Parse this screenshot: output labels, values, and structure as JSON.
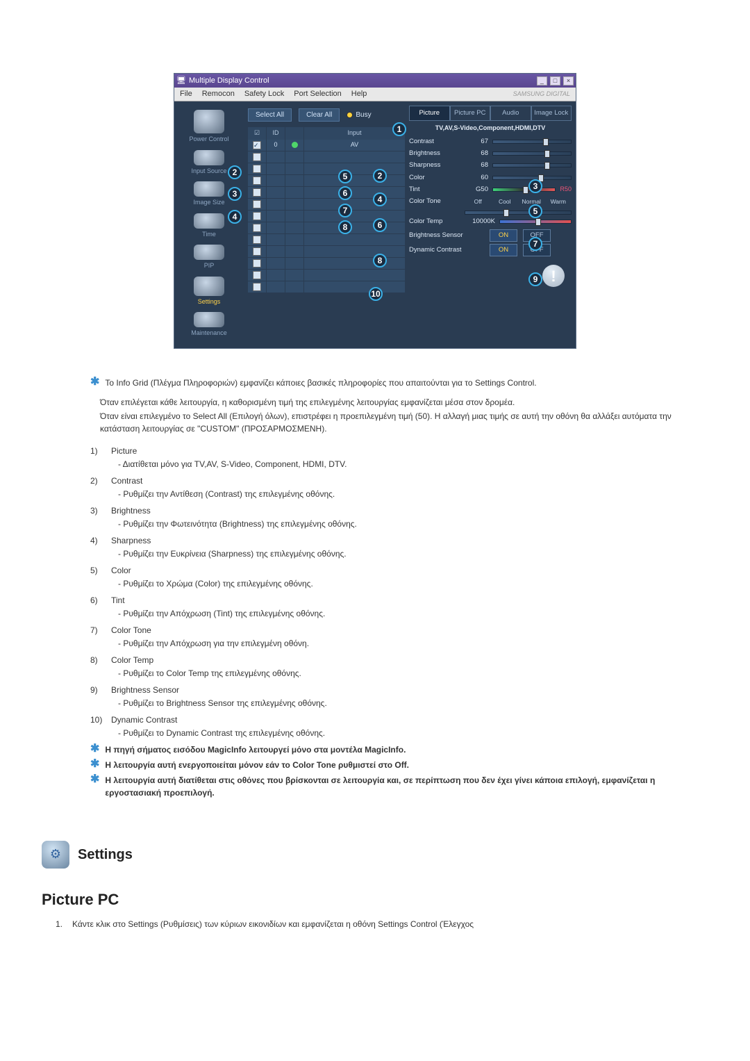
{
  "app": {
    "title": "Multiple Display Control",
    "brand": "SAMSUNG DIGITAL",
    "menus": [
      "File",
      "Remocon",
      "Safety Lock",
      "Port Selection",
      "Help"
    ],
    "buttons": {
      "select_all": "Select All",
      "clear_all": "Clear All",
      "busy": "Busy"
    },
    "sidebar": [
      {
        "label": "Power Control"
      },
      {
        "label": ""
      },
      {
        "label": "Input Source"
      },
      {
        "label": "Image Size"
      },
      {
        "label": "Time"
      },
      {
        "label": "PIP"
      },
      {
        "label": "Settings"
      },
      {
        "label": "Maintenance"
      }
    ],
    "grid": {
      "col_id": "ID",
      "col_input": "Input",
      "row0_id": "0",
      "row0_input": "AV"
    },
    "tabs": [
      "Picture",
      "Picture PC",
      "Audio",
      "Image Lock"
    ],
    "sub_header": "TV,AV,S-Video,Component,HDMI,DTV",
    "sliders": {
      "contrast": {
        "label": "Contrast",
        "value": "67"
      },
      "brightness": {
        "label": "Brightness",
        "value": "68"
      },
      "sharpness": {
        "label": "Sharpness",
        "value": "68"
      },
      "color": {
        "label": "Color",
        "value": "60"
      },
      "tint": {
        "label": "Tint",
        "value": "G50",
        "right": "R50"
      },
      "color_tone": {
        "label": "Color Tone",
        "opts": [
          "Off",
          "Cool",
          "Normal",
          "Warm"
        ]
      },
      "color_temp": {
        "label": "Color Temp",
        "value": "10000K"
      },
      "bsensor": {
        "label": "Brightness Sensor",
        "on": "ON",
        "off": "OFF"
      },
      "dcontrast": {
        "label": "Dynamic Contrast",
        "on": "ON",
        "off": "OFF"
      }
    }
  },
  "callouts": {
    "n1": "1",
    "n2": "2",
    "n3": "3",
    "n4": "4",
    "n5": "5",
    "n6": "6",
    "n7": "7",
    "n8": "8",
    "n9": "9",
    "n10": "10"
  },
  "text": {
    "intro": "Το Info Grid (Πλέγμα Πληροφοριών) εμφανίζει κάποιες βασικές πληροφορίες που απαιτούνται για το Settings Control.",
    "p1": "Όταν επιλέγεται κάθε λειτουργία, η καθορισμένη τιμή της επιλεγμένης λειτουργίας εμφανίζεται μέσα στον δρομέα.",
    "p2": "Όταν είναι επιλεγμένο το Select All (Επιλογή όλων), επιστρέφει η προεπιλεγμένη τιμή (50). Η αλλαγή μιας τιμής σε αυτή την οθόνη θα αλλάξει αυτόματα την κατάσταση λειτουργίας σε \"CUSTOM\" (ΠΡΟΣΑΡΜΟΣΜΕΝΗ).",
    "items": [
      {
        "n": "1)",
        "t": "Picture",
        "d": "- Διατίθεται μόνο για TV,AV, S-Video, Component, HDMI, DTV."
      },
      {
        "n": "2)",
        "t": "Contrast",
        "d": "- Ρυθμίζει την Αντίθεση (Contrast) της επιλεγμένης οθόνης."
      },
      {
        "n": "3)",
        "t": "Brightness",
        "d": "- Ρυθμίζει την Φωτεινότητα (Brightness) της επιλεγμένης οθόνης."
      },
      {
        "n": "4)",
        "t": "Sharpness",
        "d": "- Ρυθμίζει την Ευκρίνεια (Sharpness) της επιλεγμένης οθόνης."
      },
      {
        "n": "5)",
        "t": "Color",
        "d": "- Ρυθμίζει το Χρώμα (Color) της επιλεγμένης οθόνης."
      },
      {
        "n": "6)",
        "t": "Tint",
        "d": "- Ρυθμίζει την Απόχρωση (Tint) της επιλεγμένης οθόνης."
      },
      {
        "n": "7)",
        "t": "Color Tone",
        "d": "- Ρυθμίζει την Απόχρωση για την επιλεγμένη οθόνη."
      },
      {
        "n": "8)",
        "t": "Color Temp",
        "d": "- Ρυθμίζει το Color Temp της επιλεγμένης οθόνης."
      },
      {
        "n": "9)",
        "t": "Brightness Sensor",
        "d": "- Ρυθμίζει το Brightness Sensor της επιλεγμένης οθόνης."
      },
      {
        "n": "10)",
        "t": "Dynamic Contrast",
        "d": "- Ρυθμίζει το Dynamic Contrast της επιλεγμένης οθόνης."
      }
    ],
    "star_notes": [
      "Η πηγή σήματος εισόδου MagicInfo λειτουργεί μόνο στα μοντέλα MagicInfo.",
      "Η λειτουργία αυτή ενεργοποιείται μόνον εάν το Color Tone ρυθμιστεί στο Off.",
      "Η λειτουργία αυτή διατίθεται στις οθόνες που βρίσκονται σε λειτουργία και, σε περίπτωση που δεν έχει γίνει κάποια επιλογή, εμφανίζεται η εργοστασιακή προεπιλογή."
    ],
    "section_title": "Settings",
    "h2": "Picture PC",
    "final_n": "1.",
    "final": "Κάντε κλικ στο Settings (Ρυθμίσεις) των κύριων εικονιδίων και εμφανίζεται η οθόνη Settings Control (Έλεγχος"
  }
}
